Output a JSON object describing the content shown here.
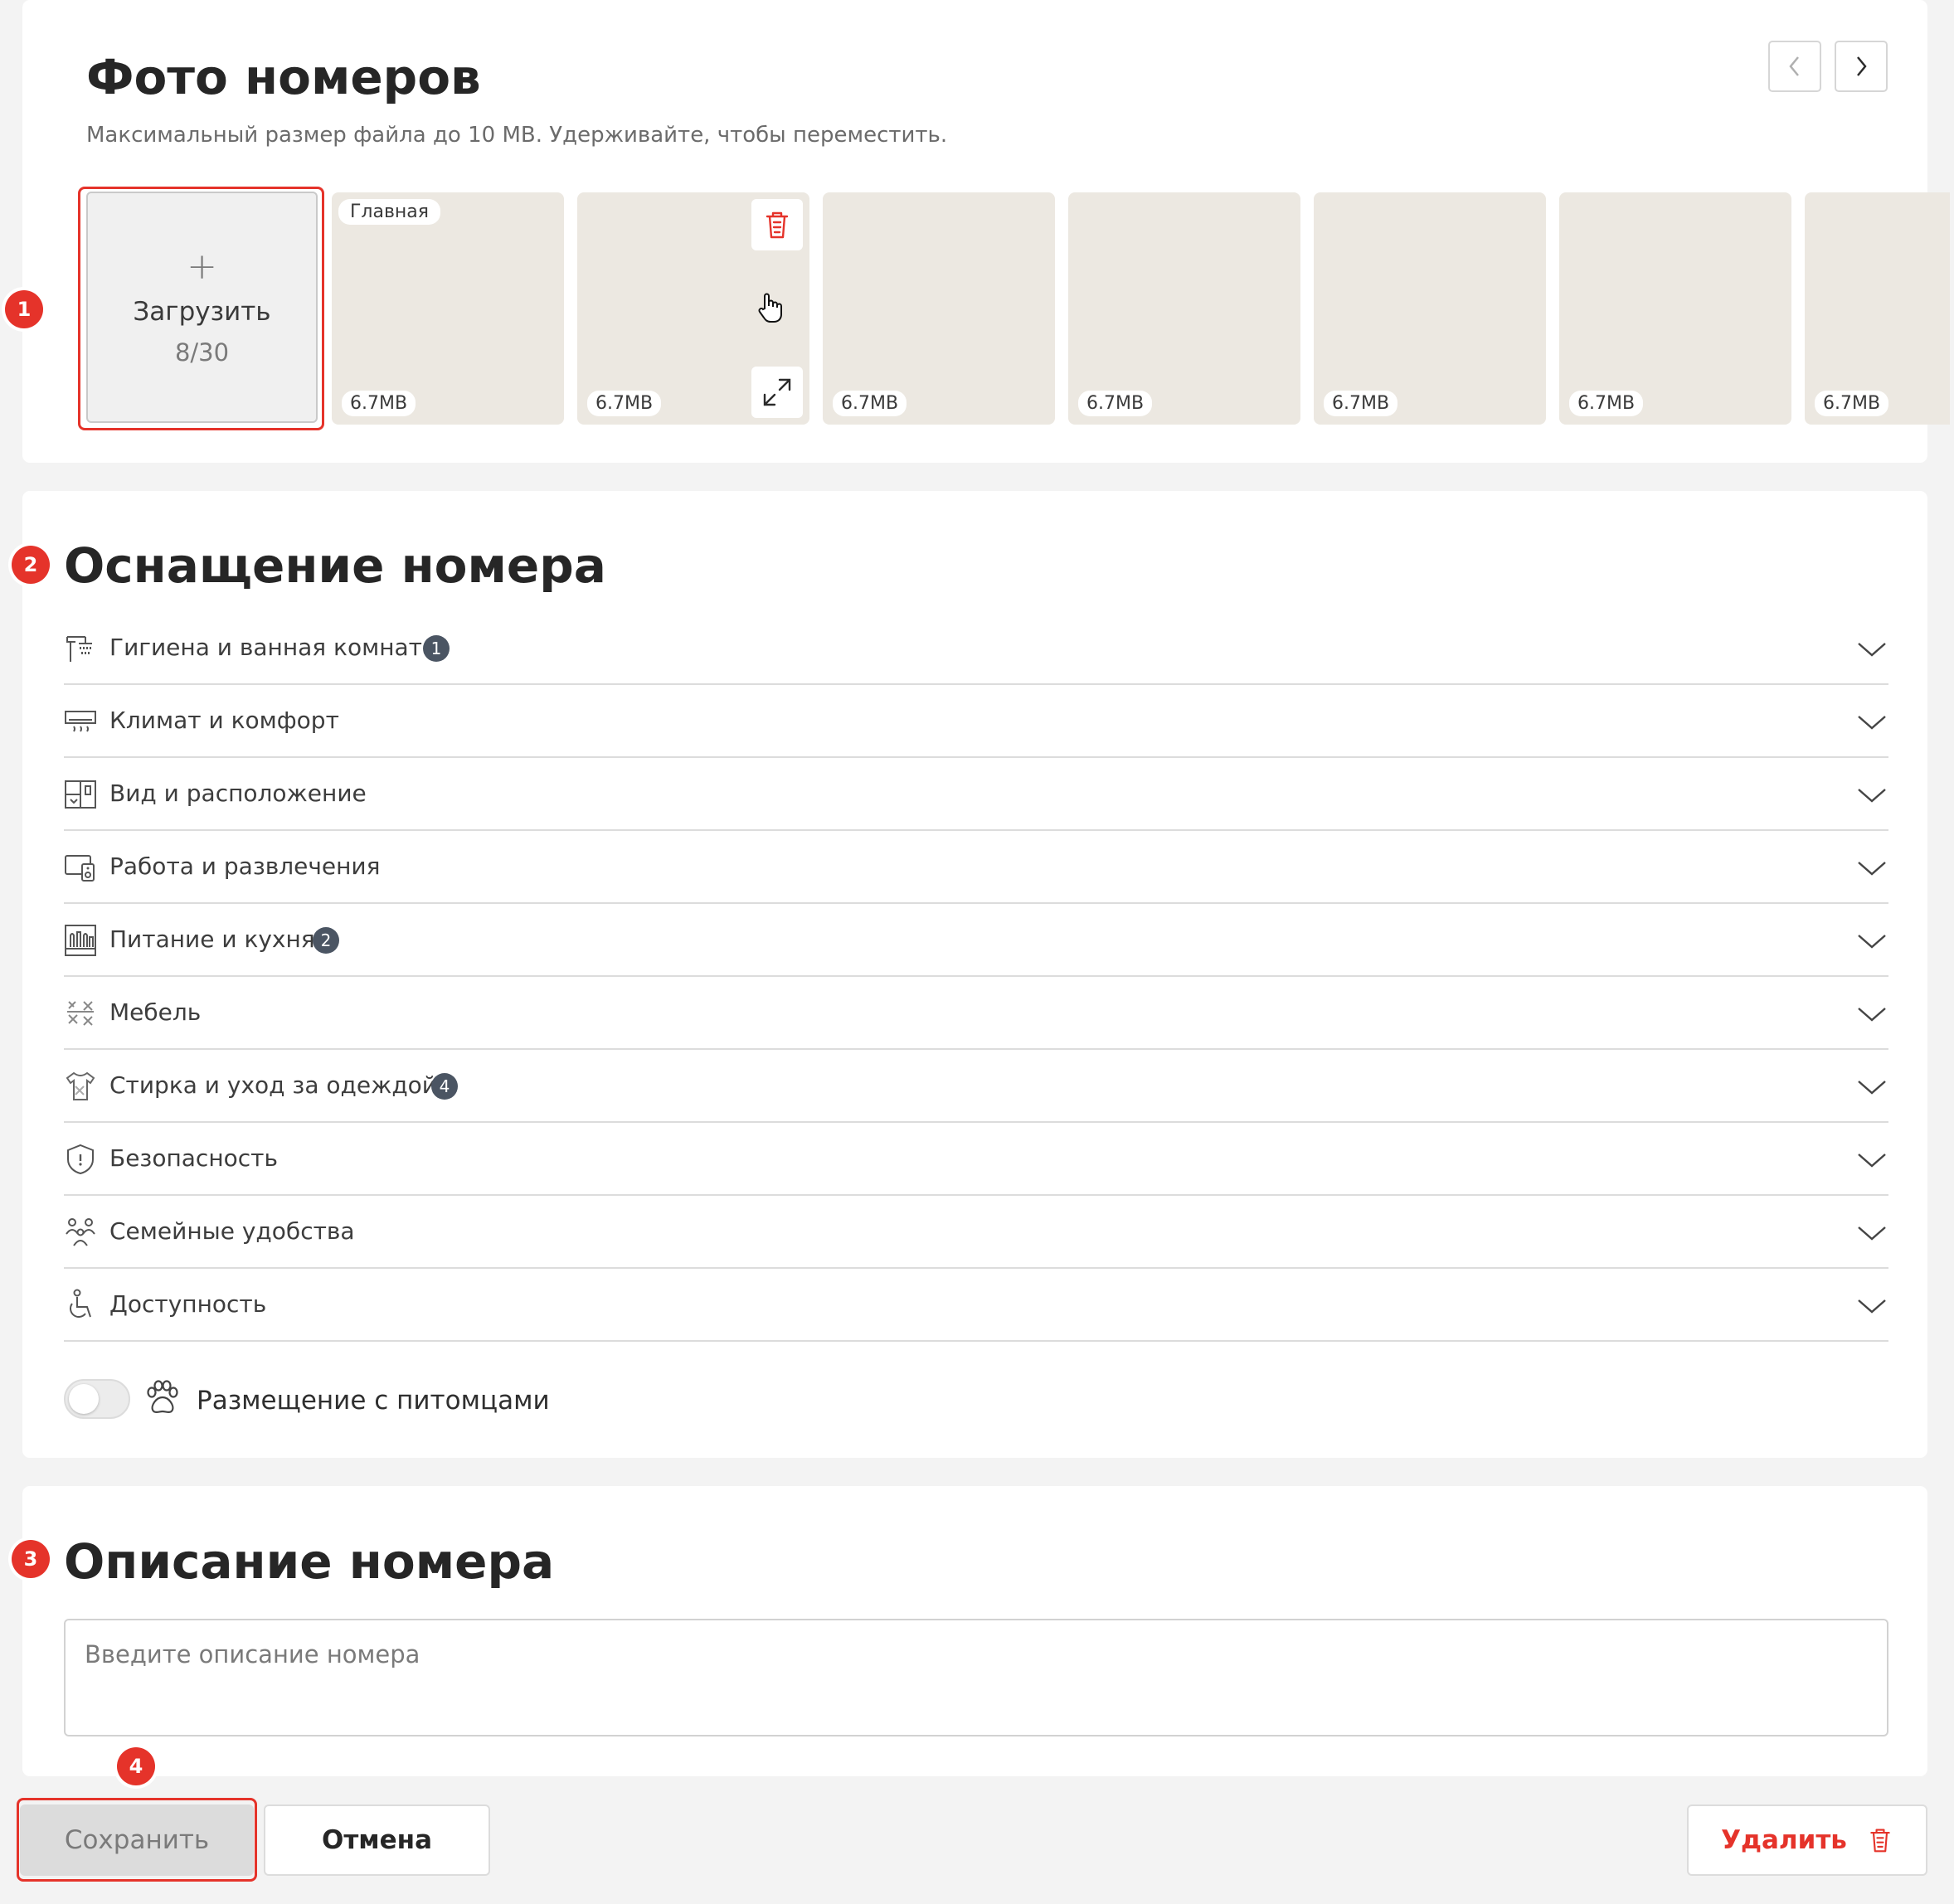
{
  "photos_section": {
    "title": "Фото номеров",
    "subtitle": "Максимальный размер файла до 10 MB. Удерживайте, чтобы переместить.",
    "upload": {
      "plus": "+",
      "label": "Загрузить",
      "count": "8/30"
    },
    "main_badge": "Главная",
    "photos": [
      {
        "size": "6.7MB"
      },
      {
        "size": "6.7MB"
      },
      {
        "size": "6.7MB"
      },
      {
        "size": "6.7MB"
      },
      {
        "size": "6.7MB"
      },
      {
        "size": "6.7MB"
      },
      {
        "size": "6.7MB"
      }
    ]
  },
  "amenities_section": {
    "title": "Оснащение номера",
    "items": [
      {
        "label": "Гигиена и ванная комната",
        "count": "1",
        "icon": "shower-icon"
      },
      {
        "label": "Климат и комфорт",
        "count": "",
        "icon": "air-conditioner-icon"
      },
      {
        "label": "Вид и расположение",
        "count": "",
        "icon": "window-view-icon"
      },
      {
        "label": "Работа и развлечения",
        "count": "",
        "icon": "workstation-icon"
      },
      {
        "label": "Питание и кухня",
        "count": "2",
        "icon": "kitchen-icon"
      },
      {
        "label": "Мебель",
        "count": "",
        "icon": "furniture-icon"
      },
      {
        "label": "Стирка и уход за одеждой",
        "count": "4",
        "icon": "laundry-icon"
      },
      {
        "label": "Безопасность",
        "count": "",
        "icon": "shield-icon"
      },
      {
        "label": "Семейные удобства",
        "count": "",
        "icon": "family-icon"
      },
      {
        "label": "Доступность",
        "count": "",
        "icon": "wheelchair-icon"
      }
    ],
    "pets_label": "Размещение с питомцами",
    "pets_enabled": false
  },
  "description_section": {
    "title": "Описание номера",
    "placeholder": "Введите описание номера"
  },
  "buttons": {
    "save": "Сохранить",
    "cancel": "Отмена",
    "delete": "Удалить"
  },
  "markers": [
    "1",
    "2",
    "3",
    "4"
  ],
  "colors": {
    "accent": "#e5332a",
    "photo_placeholder": "#ece8e1",
    "badge": "#4b5563"
  }
}
